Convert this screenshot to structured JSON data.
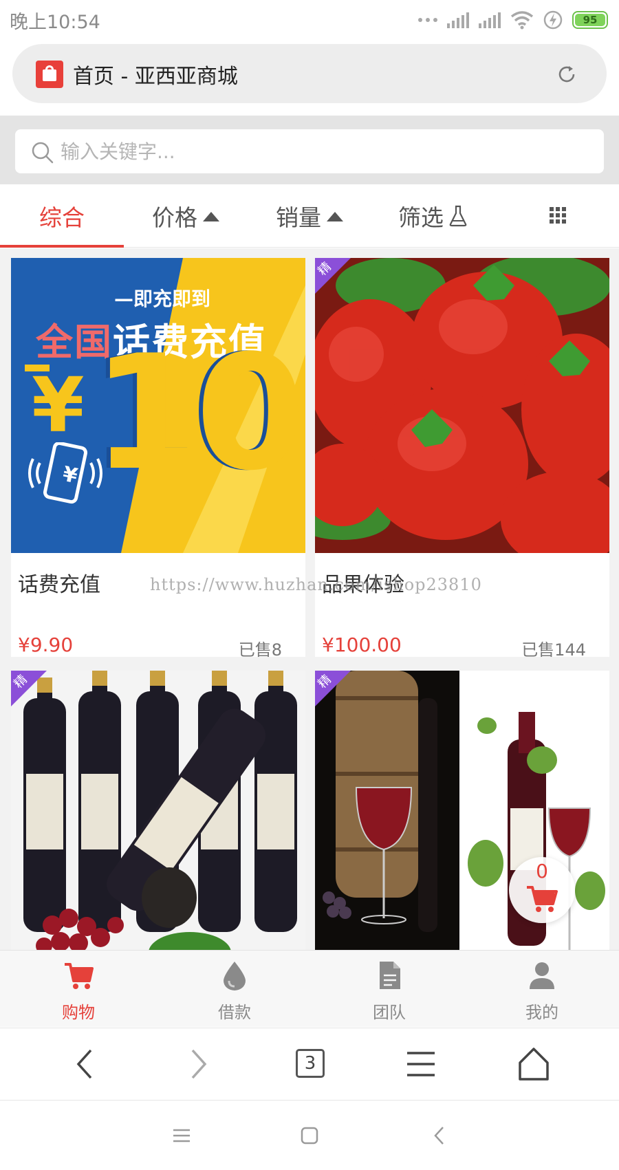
{
  "status_bar": {
    "time": "晚上10:54",
    "battery": "95"
  },
  "browser": {
    "page_title": "首页 - 亚西亚商城",
    "tab_count": "3"
  },
  "search": {
    "placeholder": "输入关键字..."
  },
  "sort_tabs": [
    {
      "label": "综合",
      "active": true
    },
    {
      "label": "价格",
      "indicator": "triangle-up-icon"
    },
    {
      "label": "销量",
      "indicator": "triangle-up-icon"
    },
    {
      "label": "筛选",
      "indicator": "flask-icon"
    }
  ],
  "products": [
    {
      "name": "话费充值",
      "price": "¥9.90",
      "sold": "已售8",
      "image": {
        "tagline": "—即充即到",
        "title_red": "全国",
        "title_white": "话费充值",
        "amount": "10",
        "currency": "¥"
      }
    },
    {
      "name": "品果体验",
      "price": "¥100.00",
      "sold": "已售144",
      "badge": "精"
    },
    {
      "name": "",
      "price": "",
      "sold": "",
      "badge": "精"
    },
    {
      "name": "",
      "price": "",
      "sold": "",
      "badge": "精"
    }
  ],
  "watermark": "https://www.huzhan.com/ishop23810",
  "floating_cart": {
    "count": "0"
  },
  "bottom_nav": [
    {
      "label": "购物",
      "icon": "cart-icon",
      "active": true
    },
    {
      "label": "借款",
      "icon": "drop-icon"
    },
    {
      "label": "团队",
      "icon": "document-icon"
    },
    {
      "label": "我的",
      "icon": "user-icon"
    }
  ],
  "colors": {
    "accent": "#e5413a",
    "badge": "#8b4fd8",
    "banner_blue": "#1f5fb0",
    "banner_yellow": "#f7c51c"
  }
}
